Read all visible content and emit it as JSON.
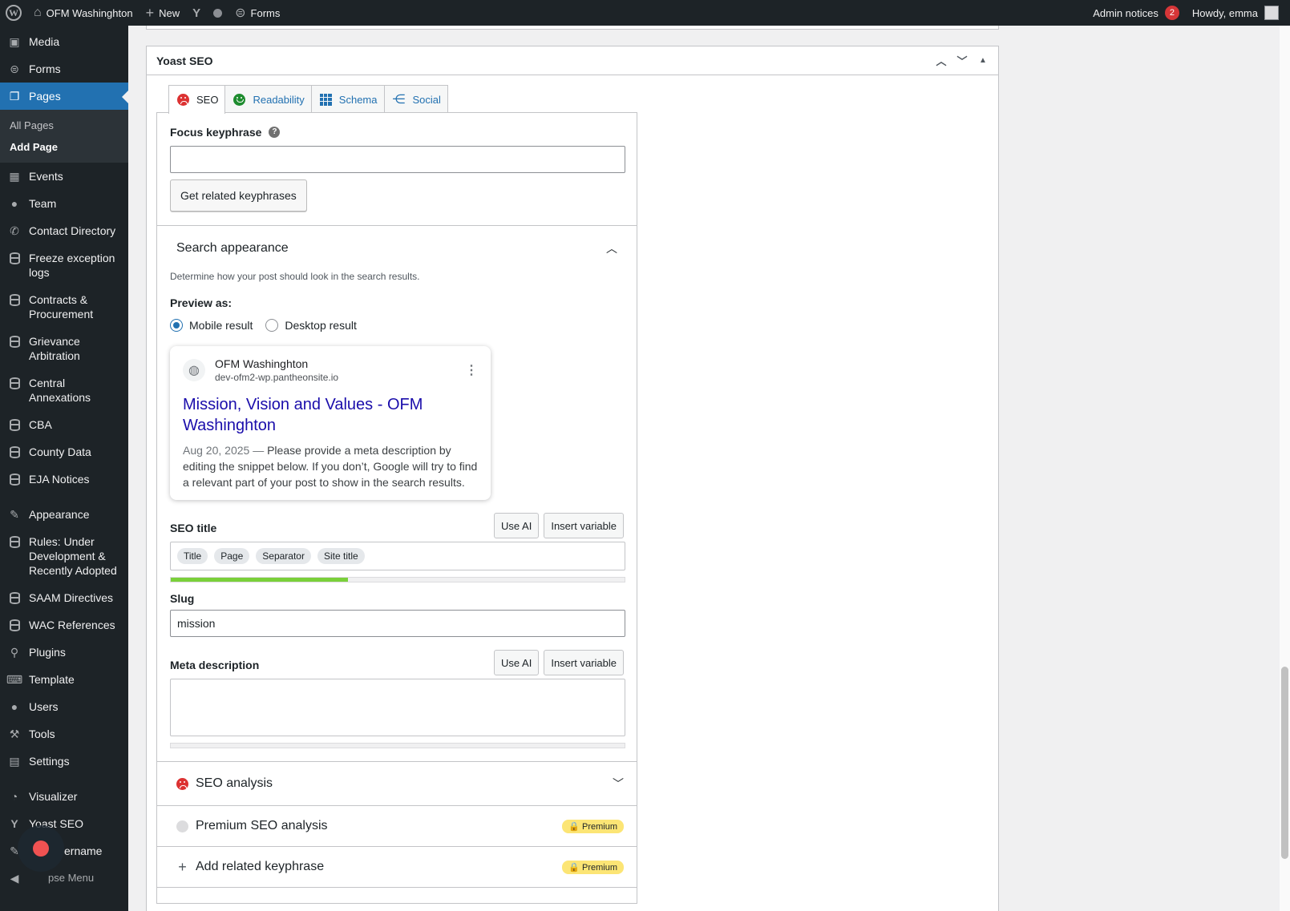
{
  "admin_bar": {
    "site_name": "OFM Washinghton",
    "new_label": "New",
    "forms_label": "Forms",
    "admin_notices_label": "Admin notices",
    "admin_notices_count": "2",
    "howdy": "Howdy, emma"
  },
  "sidebar": {
    "media": "Media",
    "forms": "Forms",
    "pages": "Pages",
    "all_pages": "All Pages",
    "add_page": "Add Page",
    "events": "Events",
    "team": "Team",
    "contact_directory": "Contact Directory",
    "freeze_exception": "Freeze exception logs",
    "contracts": "Contracts & Procurement",
    "grievance": "Grievance Arbitration",
    "central_annexations": "Central Annexations",
    "cba": "CBA",
    "county_data": "County Data",
    "eja_notices": "EJA Notices",
    "appearance": "Appearance",
    "rules": "Rules: Under Development & Recently Adopted",
    "saam": "SAAM Directives",
    "wac": "WAC References",
    "plugins": "Plugins",
    "template": "Template",
    "users": "Users",
    "tools": "Tools",
    "settings": "Settings",
    "visualizer": "Visualizer",
    "yoast": "Yoast SEO",
    "username": "ername",
    "collapse": "pse Menu"
  },
  "yoast_box": {
    "title": "Yoast SEO",
    "tabs": {
      "seo": "SEO",
      "readability": "Readability",
      "schema": "Schema",
      "social": "Social"
    },
    "focus_keyphrase_label": "Focus keyphrase",
    "focus_keyphrase_value": "",
    "related_keyphrases_button": "Get related keyphrases",
    "search_appearance": {
      "title": "Search appearance",
      "description": "Determine how your post should look in the search results.",
      "preview_as_label": "Preview as:",
      "mobile_label": "Mobile result",
      "desktop_label": "Desktop result",
      "mobile_selected": true
    },
    "google_preview": {
      "site_name": "OFM Washinghton",
      "url": "dev-ofm2-wp.pantheonsite.io",
      "title": "Mission, Vision and Values - OFM Washinghton",
      "date": "Aug 20, 2025",
      "dash": "—",
      "description": "Please provide a meta description by editing the snippet below. If you don’t, Google will try to find a relevant part of your post to show in the search results."
    },
    "seo_title": {
      "label": "SEO title",
      "use_ai": "Use AI",
      "insert_variable": "Insert variable",
      "pills": [
        "Title",
        "Page",
        "Separator",
        "Site title"
      ],
      "progress": 0.39
    },
    "slug": {
      "label": "Slug",
      "value": "mission"
    },
    "meta_description": {
      "label": "Meta description",
      "use_ai": "Use AI",
      "insert_variable": "Insert variable",
      "value": ""
    },
    "seo_analysis": "SEO analysis",
    "premium_seo_analysis": "Premium SEO analysis",
    "add_related_keyphrase": "Add related keyphrase",
    "premium_badge": "Premium"
  },
  "colors": {
    "admin_bar_bg": "#1d2327",
    "accent_blue": "#2271b1",
    "google_link": "#1a0dab",
    "bad_red": "#dc3232",
    "good_green": "#1e8c2f",
    "progress_green": "#7ad03a",
    "premium_yellow": "#fce575"
  }
}
